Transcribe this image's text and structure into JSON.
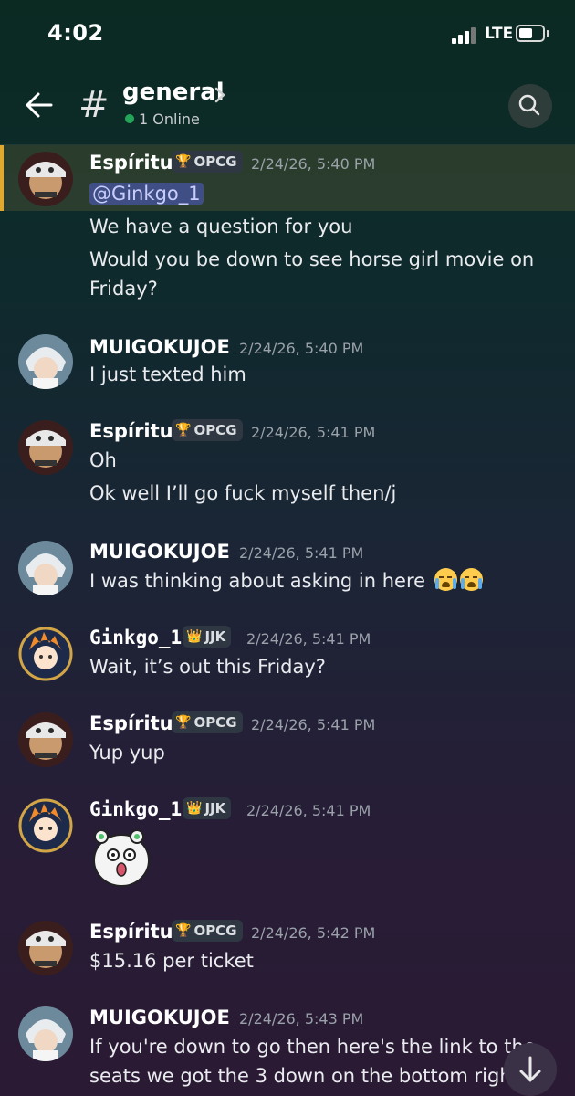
{
  "status": {
    "time": "4:02",
    "network": "LTE"
  },
  "header": {
    "channel": "general",
    "online": "1 Online"
  },
  "tags": {
    "opcg": "OPCG",
    "jjk": "JJK"
  },
  "messages": [
    {
      "user": "Espíritu",
      "tag": "OPCG",
      "time": "2/24/26, 5:40 PM",
      "mention": "@Ginkgo_1",
      "lines": [
        "We have a question for you",
        "Would you be down to see horse girl movie on",
        "Friday?"
      ]
    },
    {
      "user": "MUIGOKUJOE",
      "time": "2/24/26, 5:40 PM",
      "lines": [
        "I just texted him"
      ]
    },
    {
      "user": "Espíritu",
      "tag": "OPCG",
      "time": "2/24/26, 5:41 PM",
      "lines": [
        "Oh",
        "Ok well I’ll go fuck myself then/j"
      ]
    },
    {
      "user": "MUIGOKUJOE",
      "time": "2/24/26, 5:41 PM",
      "lines": [
        "I was thinking about asking in here"
      ],
      "emoji": [
        "loudly-crying-face",
        "loudly-crying-face"
      ]
    },
    {
      "user": "Ginkgo_1",
      "tag": "JJK",
      "time": "2/24/26, 5:41 PM",
      "lines": [
        "Wait, it’s out this Friday?"
      ]
    },
    {
      "user": "Espíritu",
      "tag": "OPCG",
      "time": "2/24/26, 5:41 PM",
      "lines": [
        "Yup yup"
      ]
    },
    {
      "user": "Ginkgo_1",
      "tag": "JJK",
      "time": "2/24/26, 5:41 PM",
      "sticker": "shocked-hamster-sticker"
    },
    {
      "user": "Espíritu",
      "tag": "OPCG",
      "time": "2/24/26, 5:42 PM",
      "lines": [
        "$15.16 per ticket"
      ]
    },
    {
      "user": "MUIGOKUJOE",
      "time": "2/24/26, 5:43 PM",
      "lines": [
        "If you're down to go then here's the link to the",
        "seats we got the 3 down on the bottom right"
      ]
    }
  ],
  "icons": {
    "back": "arrow-left-icon",
    "channel": "hash-icon",
    "search": "search-icon",
    "scroll": "arrow-down-icon"
  },
  "colors": {
    "accent": "#e0a82e",
    "online": "#23a559",
    "mention": "#5865f2"
  }
}
